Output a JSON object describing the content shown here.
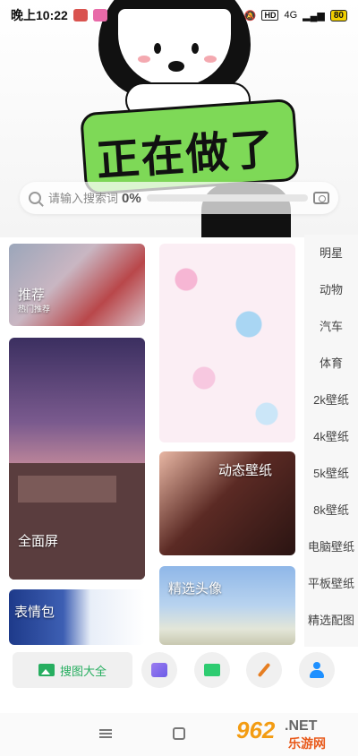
{
  "status_bar": {
    "time": "晚上10:22",
    "network": "4G",
    "battery": "80"
  },
  "banner": {
    "text": "正在做了"
  },
  "search": {
    "placeholder": "请输入搜索词",
    "progress_text": "0%",
    "progress": 0
  },
  "cards": {
    "recommend": {
      "title": "推荐",
      "subtitle": "热门推荐"
    },
    "fullscreen": {
      "title": "全面屏"
    },
    "sticker": {
      "title": "表情包"
    },
    "live": {
      "title": "动态壁纸"
    },
    "avatar": {
      "title": "精选头像"
    }
  },
  "categories": [
    "明星",
    "动物",
    "汽车",
    "体育",
    "2k壁纸",
    "4k壁纸",
    "5k壁纸",
    "8k壁纸",
    "电脑壁纸",
    "平板壁纸",
    "精选配图"
  ],
  "toolbar": {
    "search_all": "搜图大全"
  },
  "watermark": {
    "num": "962",
    "net": ".NET",
    "cn": "乐游网"
  },
  "colors": {
    "accent": "#27ae60",
    "banner_green": "#7ed957"
  }
}
